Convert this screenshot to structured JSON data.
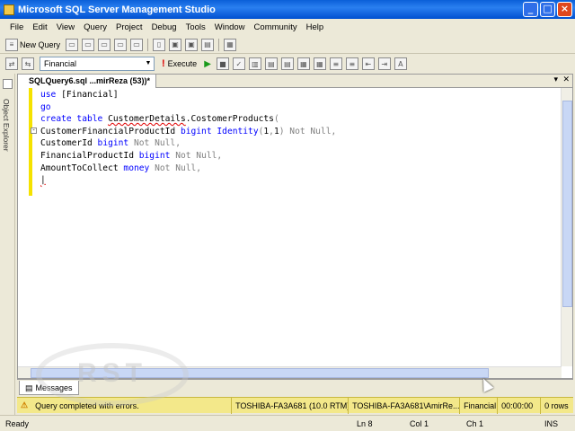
{
  "window": {
    "title": "Microsoft SQL Server Management Studio"
  },
  "menu": [
    "File",
    "Edit",
    "View",
    "Query",
    "Project",
    "Debug",
    "Tools",
    "Window",
    "Community",
    "Help"
  ],
  "toolbar": {
    "new_query_label": "New Query"
  },
  "toolbar2": {
    "database": "Financial",
    "execute_label": "Execute"
  },
  "sidebar": {
    "label": "Object Explorer"
  },
  "tab": {
    "title": "SQLQuery6.sql ...mirReza (53))*"
  },
  "editor": {
    "lines": [
      "use [Financial]",
      "go",
      "create table CustomerDetails.CostomerProducts(",
      "CustomerFinancialProductId bigint Identity(1,1) Not Null,",
      "CustomerId bigint Not Null,",
      "FinancialProductId bigint Not Null,",
      "AmountToCollect money Not Null,",
      ""
    ]
  },
  "results": {
    "messages_tab": "Messages"
  },
  "query_status": {
    "message": "Query completed with errors.",
    "server": "TOSHIBA-FA3A681 (10.0 RTM)",
    "user": "TOSHIBA-FA3A681\\AmirRe...",
    "database": "Financial",
    "time": "00:00:00",
    "rows": "0 rows"
  },
  "statusbar": {
    "ready": "Ready",
    "line": "Ln 8",
    "col": "Col 1",
    "ch": "Ch 1",
    "mode": "INS"
  },
  "watermark": "RST"
}
